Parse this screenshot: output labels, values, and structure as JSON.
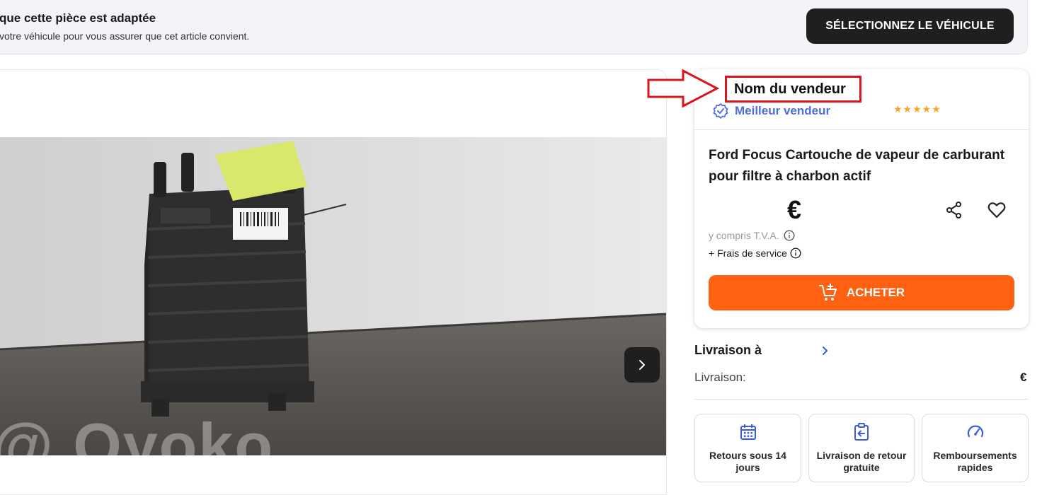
{
  "banner": {
    "title": "que cette pièce est adaptée",
    "subtitle": "votre véhicule pour vous assurer que cet article convient.",
    "select_button": "SÉLECTIONNEZ LE VÉHICULE"
  },
  "gallery": {
    "watermark": "@ Oyoko"
  },
  "seller": {
    "name": "Nom du vendeur",
    "badge": "Meilleur vendeur",
    "rating_stars": 5,
    "stars_text": "★★★★★"
  },
  "product": {
    "title": "Ford Focus Cartouche de vapeur de carburant pour filtre à charbon actif",
    "price": "€",
    "vat_note": "y compris T.V.A.",
    "service_fees": "+ Frais de service",
    "buy_label": "ACHETER"
  },
  "delivery": {
    "to_label": "Livraison à",
    "row_label": "Livraison:",
    "price": "€"
  },
  "benefits": [
    {
      "icon": "calendar-icon",
      "label": "Retours sous 14 jours"
    },
    {
      "icon": "return-box-icon",
      "label": "Livraison de retour gratuite"
    },
    {
      "icon": "speedometer-icon",
      "label": "Remboursements rapides"
    }
  ],
  "colors": {
    "accent_orange": "#ff6112",
    "badge_blue": "#4f6de6",
    "star_gold": "#f5a623",
    "highlight_red": "#d9141c",
    "dark_button": "#1f1f1f"
  }
}
